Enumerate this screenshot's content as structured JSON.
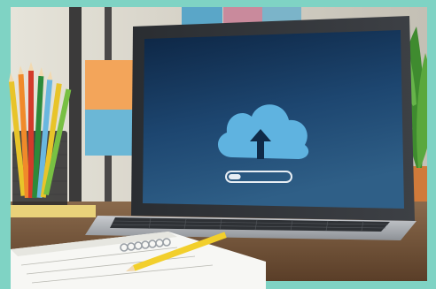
{
  "scene": {
    "subject": "laptop-cloud-upload",
    "screen_icon": "cloud-upload-icon",
    "upload_progress": 0.2,
    "colors": {
      "border": "#7fd3c4",
      "wall": "#d9d4c8",
      "screen_top": "#0f2a48",
      "screen_bottom": "#2c5a82",
      "cloud": "#5fb3e0",
      "laptop_body": "#b9bdc2",
      "desk": "#7a5a3e",
      "pencil_yellow": "#f2cf2c",
      "plant_green": "#3f8b2f"
    }
  }
}
